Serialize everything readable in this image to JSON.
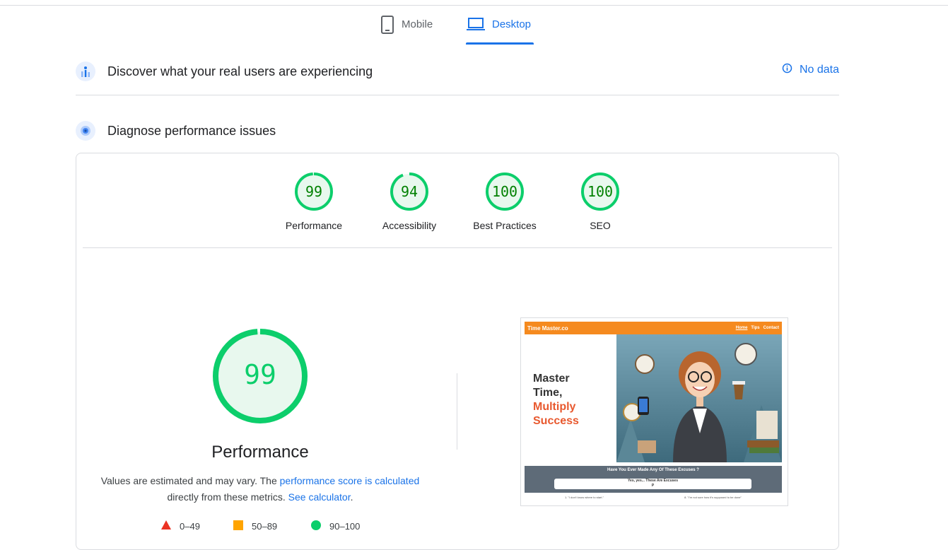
{
  "tabs": {
    "mobile_label": "Mobile",
    "desktop_label": "Desktop",
    "active": "Desktop"
  },
  "field_data": {
    "title": "Discover what your real users are experiencing",
    "status_label": "No data"
  },
  "lab_data": {
    "title": "Diagnose performance issues"
  },
  "categories": [
    {
      "label": "Performance",
      "score": 99
    },
    {
      "label": "Accessibility",
      "score": 94
    },
    {
      "label": "Best Practices",
      "score": 100
    },
    {
      "label": "SEO",
      "score": 100
    }
  ],
  "performance": {
    "score": 99,
    "title": "Performance",
    "desc_prefix": "Values are estimated and may vary. The ",
    "desc_link": "performance score is calculated",
    "desc_middle": " directly from these metrics. ",
    "desc_link2": "See calculator",
    "desc_suffix": "."
  },
  "legend": [
    {
      "range": "0–49",
      "color": "#eb3223",
      "shape": "triangle"
    },
    {
      "range": "50–89",
      "color": "#ffa400",
      "shape": "square"
    },
    {
      "range": "90–100",
      "color": "#0cce6b",
      "shape": "circle"
    }
  ],
  "colors": {
    "accent": "#1a73e8",
    "pass_green": "#0cce6b",
    "pass_text": "#008000",
    "gauge_fill": "#e8f8ee"
  },
  "thumbnail": {
    "brand": "Time Master.co",
    "nav": [
      "Home",
      "Tips",
      "Contact"
    ],
    "headline_line1": "Master",
    "headline_line2": "Time,",
    "headline_line3": "Multiply",
    "headline_line4": "Success",
    "band_title": "Have You Ever Made Any Of These Excuses ?",
    "pill_line1": "Yes, yes... These Are Excuses",
    "pill_line2": "P",
    "foot_left": "1. \"I don't know where to start.\"",
    "foot_right": "8. \"I'm not sure how it's supposed to be done\""
  }
}
